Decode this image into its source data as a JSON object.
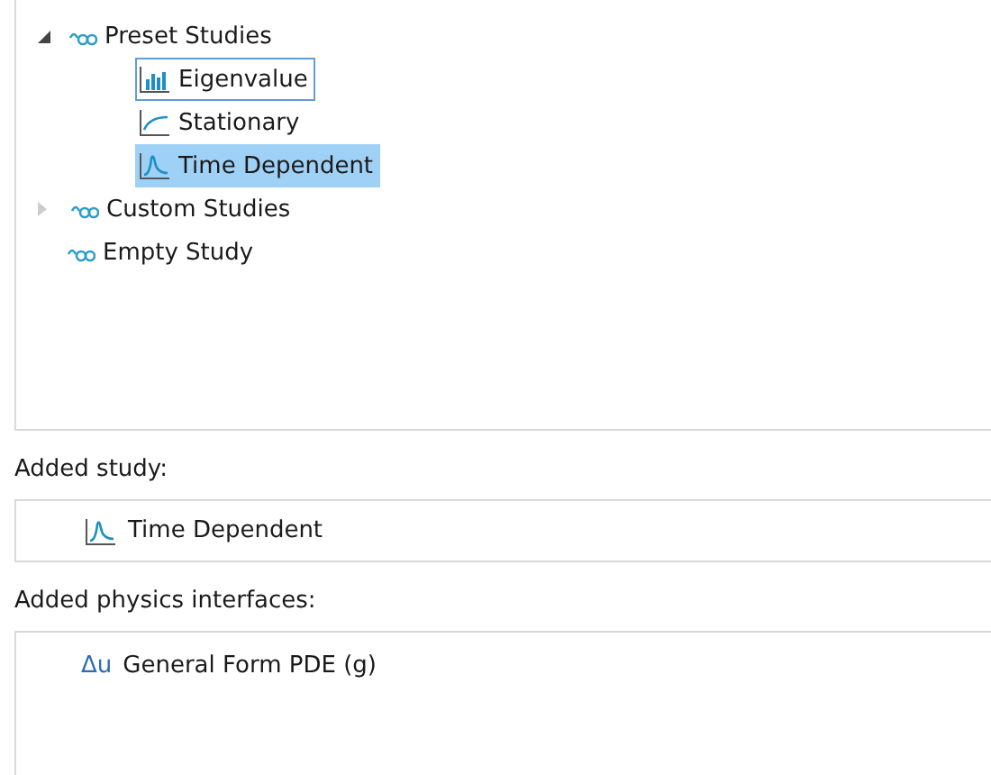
{
  "tree": [
    {
      "label": "Preset Studies",
      "kind": "group",
      "expanded": true,
      "selected": false,
      "focused": false,
      "children": [
        {
          "label": "Eigenvalue",
          "kind": "eigenvalue",
          "selected": false,
          "focused": true
        },
        {
          "label": "Stationary",
          "kind": "stationary",
          "selected": false,
          "focused": false
        },
        {
          "label": "Time Dependent",
          "kind": "time",
          "selected": true,
          "focused": false
        }
      ]
    },
    {
      "label": "Custom Studies",
      "kind": "group",
      "expanded": false,
      "selected": false,
      "focused": false
    },
    {
      "label": "Empty Study",
      "kind": "group",
      "selected": false,
      "focused": false
    }
  ],
  "added_study": {
    "label": "Added study:",
    "value": "Time Dependent",
    "kind": "time"
  },
  "added_physics": {
    "label": "Added physics interfaces:",
    "items": [
      {
        "symbol": "Δu",
        "name": "General Form PDE (g)"
      }
    ]
  }
}
